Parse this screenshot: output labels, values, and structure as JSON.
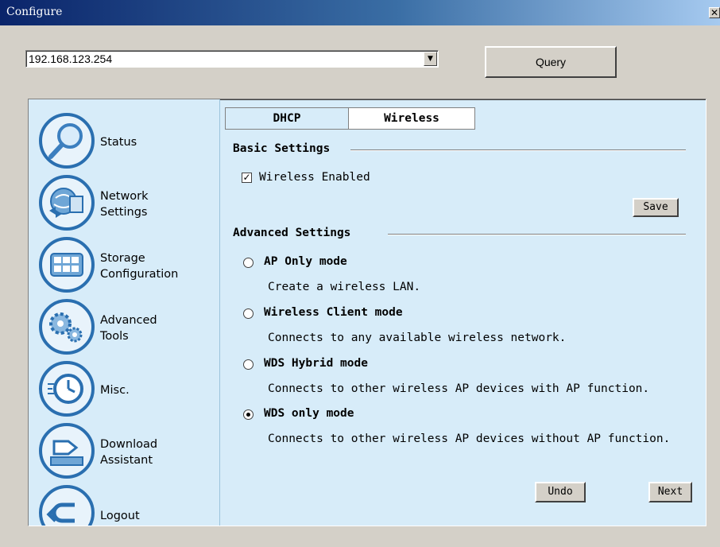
{
  "window": {
    "title": "Configure",
    "close_glyph": "✕"
  },
  "toolbar": {
    "ip_value": "192.168.123.254",
    "dropdown_glyph": "▼",
    "query_label": "Query"
  },
  "sidebar": {
    "items": [
      {
        "label": "Status",
        "icon": "magnifier-icon"
      },
      {
        "label": "Network\nSettings",
        "icon": "network-globe-icon"
      },
      {
        "label": "Storage\nConfiguration",
        "icon": "storage-grid-icon"
      },
      {
        "label": "Advanced\nTools",
        "icon": "gears-icon"
      },
      {
        "label": "Misc.",
        "icon": "clock-icon"
      },
      {
        "label": "Download\nAssistant",
        "icon": "download-tray-icon"
      },
      {
        "label": "Logout",
        "icon": "logout-arrow-icon"
      }
    ]
  },
  "tabs": {
    "dhcp": "DHCP",
    "wireless": "Wireless",
    "active": "Wireless"
  },
  "basic": {
    "title": "Basic Settings",
    "wireless_enabled_label": "Wireless Enabled",
    "wireless_enabled": true,
    "check_glyph": "✓",
    "save_label": "Save"
  },
  "advanced": {
    "title": "Advanced Settings",
    "modes": [
      {
        "label": "AP Only mode",
        "desc": "Create a wireless LAN.",
        "selected": false
      },
      {
        "label": "Wireless Client mode",
        "desc": "Connects to any available wireless network.",
        "selected": false
      },
      {
        "label": "WDS Hybrid mode",
        "desc": "Connects to other wireless AP devices with AP function.",
        "selected": false
      },
      {
        "label": "WDS only mode",
        "desc": "Connects to other wireless AP devices without AP function.",
        "selected": true
      }
    ]
  },
  "actions": {
    "undo_label": "Undo",
    "next_label": "Next"
  },
  "colors": {
    "panel_bg": "#d7ecf9",
    "icon_ring": "#2a6fb0",
    "title_bar": "#0a246a"
  }
}
